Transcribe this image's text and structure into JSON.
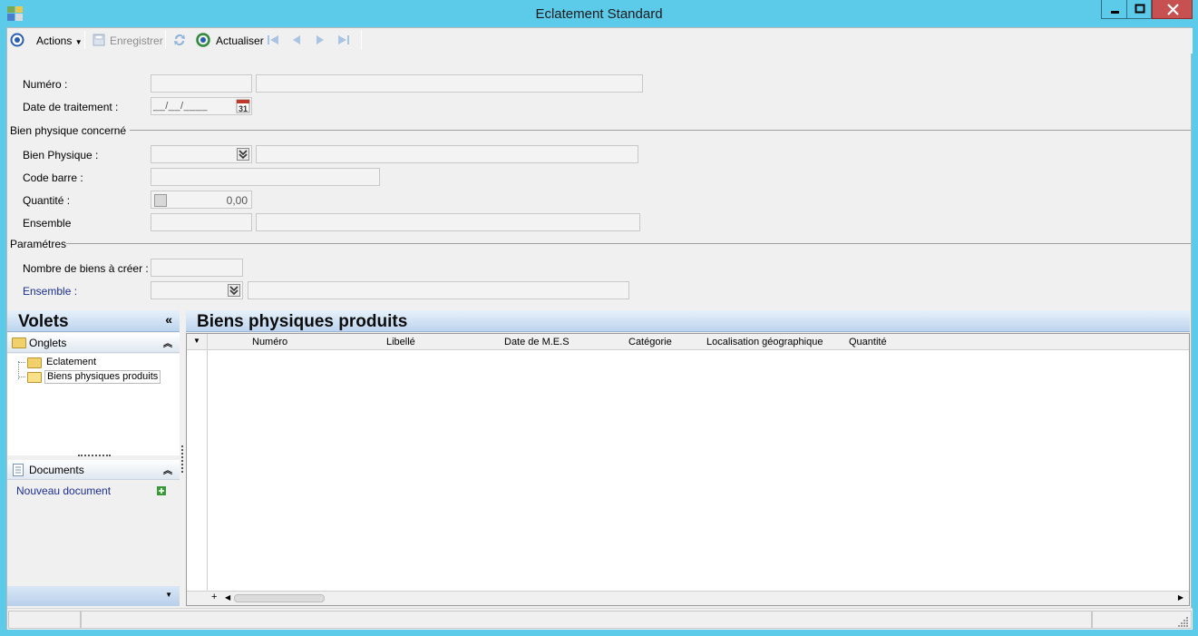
{
  "window": {
    "title": "Eclatement Standard"
  },
  "toolbar": {
    "actions_label": "Actions",
    "save_label": "Enregistrer",
    "refresh_label": "Actualiser"
  },
  "form": {
    "numero_label": "Numéro :",
    "date_label": "Date de traitement :",
    "date_value": "__/__/____",
    "section_bien": "Bien physique concerné",
    "bien_physique_label": "Bien Physique :",
    "code_barre_label": "Code barre :",
    "quantite_label": "Quantité :",
    "quantite_value": "0,00",
    "ensemble_label": "Ensemble",
    "section_params": "Paramétres",
    "nombre_label": "Nombre de biens à créer :",
    "ensemble2_label": "Ensemble :"
  },
  "volets": {
    "title": "Volets",
    "onglets_title": "Onglets",
    "items": [
      "Eclatement",
      "Biens physiques produits"
    ],
    "documents_title": "Documents",
    "new_document": "Nouveau document"
  },
  "main": {
    "title": "Biens physiques produits",
    "columns": [
      "Numéro",
      "Libellé",
      "Date de M.E.S",
      "Catégorie",
      "Localisation géographique",
      "Quantité"
    ]
  },
  "icons": [
    "app-icon",
    "actions-icon",
    "save-icon",
    "sync-icon",
    "refresh-icon",
    "first-icon",
    "prev-icon",
    "next-icon",
    "last-icon",
    "calendar-icon",
    "dropdown-icon",
    "folder-icon",
    "document-icon",
    "add-icon"
  ],
  "colors": {
    "titlebar": "#5ccbea",
    "close": "#c75050",
    "link": "#1c2f8f"
  }
}
